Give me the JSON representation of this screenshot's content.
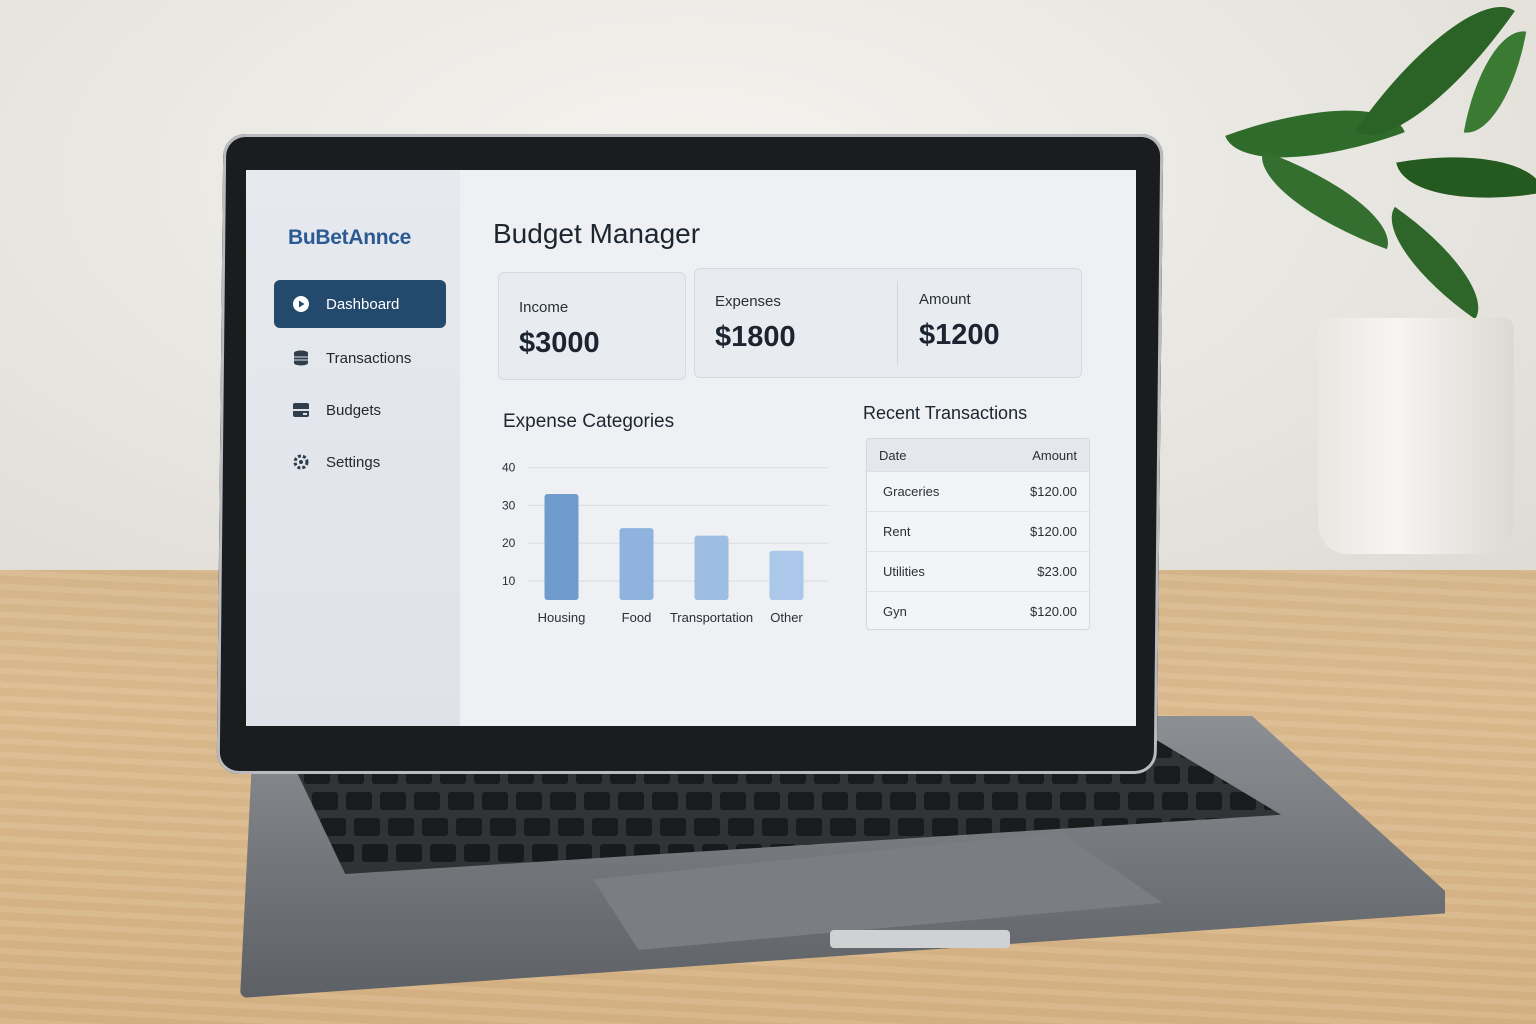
{
  "app": {
    "brand": "BuBetAnnce",
    "page_title": "Budget Manager"
  },
  "sidebar": {
    "items": [
      {
        "label": "Dashboard",
        "icon": "play-circle-icon",
        "active": true
      },
      {
        "label": "Transactions",
        "icon": "database-icon",
        "active": false
      },
      {
        "label": "Budgets",
        "icon": "wallet-icon",
        "active": false
      },
      {
        "label": "Settings",
        "icon": "gear-icon",
        "active": false
      }
    ]
  },
  "summary": {
    "income": {
      "label": "Income",
      "value": "$3000"
    },
    "expenses": {
      "label": "Expenses",
      "value": "$1800"
    },
    "amount": {
      "label": "Amount",
      "value": "$1200"
    }
  },
  "expense_section": {
    "title": "Expense Categories"
  },
  "chart_data": {
    "type": "bar",
    "categories": [
      "Housing",
      "Food",
      "Transportation",
      "Other"
    ],
    "values": [
      33,
      24,
      22,
      18
    ],
    "y_ticks": [
      10,
      20,
      30,
      40
    ],
    "ylim": [
      5,
      42
    ],
    "grid": true,
    "colors": [
      "#6f9bcd",
      "#8fb3de",
      "#9dbde3",
      "#abc8ea"
    ]
  },
  "transactions": {
    "title": "Recent Transactions",
    "columns": [
      "Date",
      "Amount"
    ],
    "rows": [
      {
        "name": "Graceries",
        "amount": "$120.00"
      },
      {
        "name": "Rent",
        "amount": "$120.00"
      },
      {
        "name": "Utilities",
        "amount": "$23.00"
      },
      {
        "name": "Gyn",
        "amount": "$120.00"
      }
    ]
  },
  "colors": {
    "accent": "#234a6d",
    "brand": "#2b5a92"
  }
}
